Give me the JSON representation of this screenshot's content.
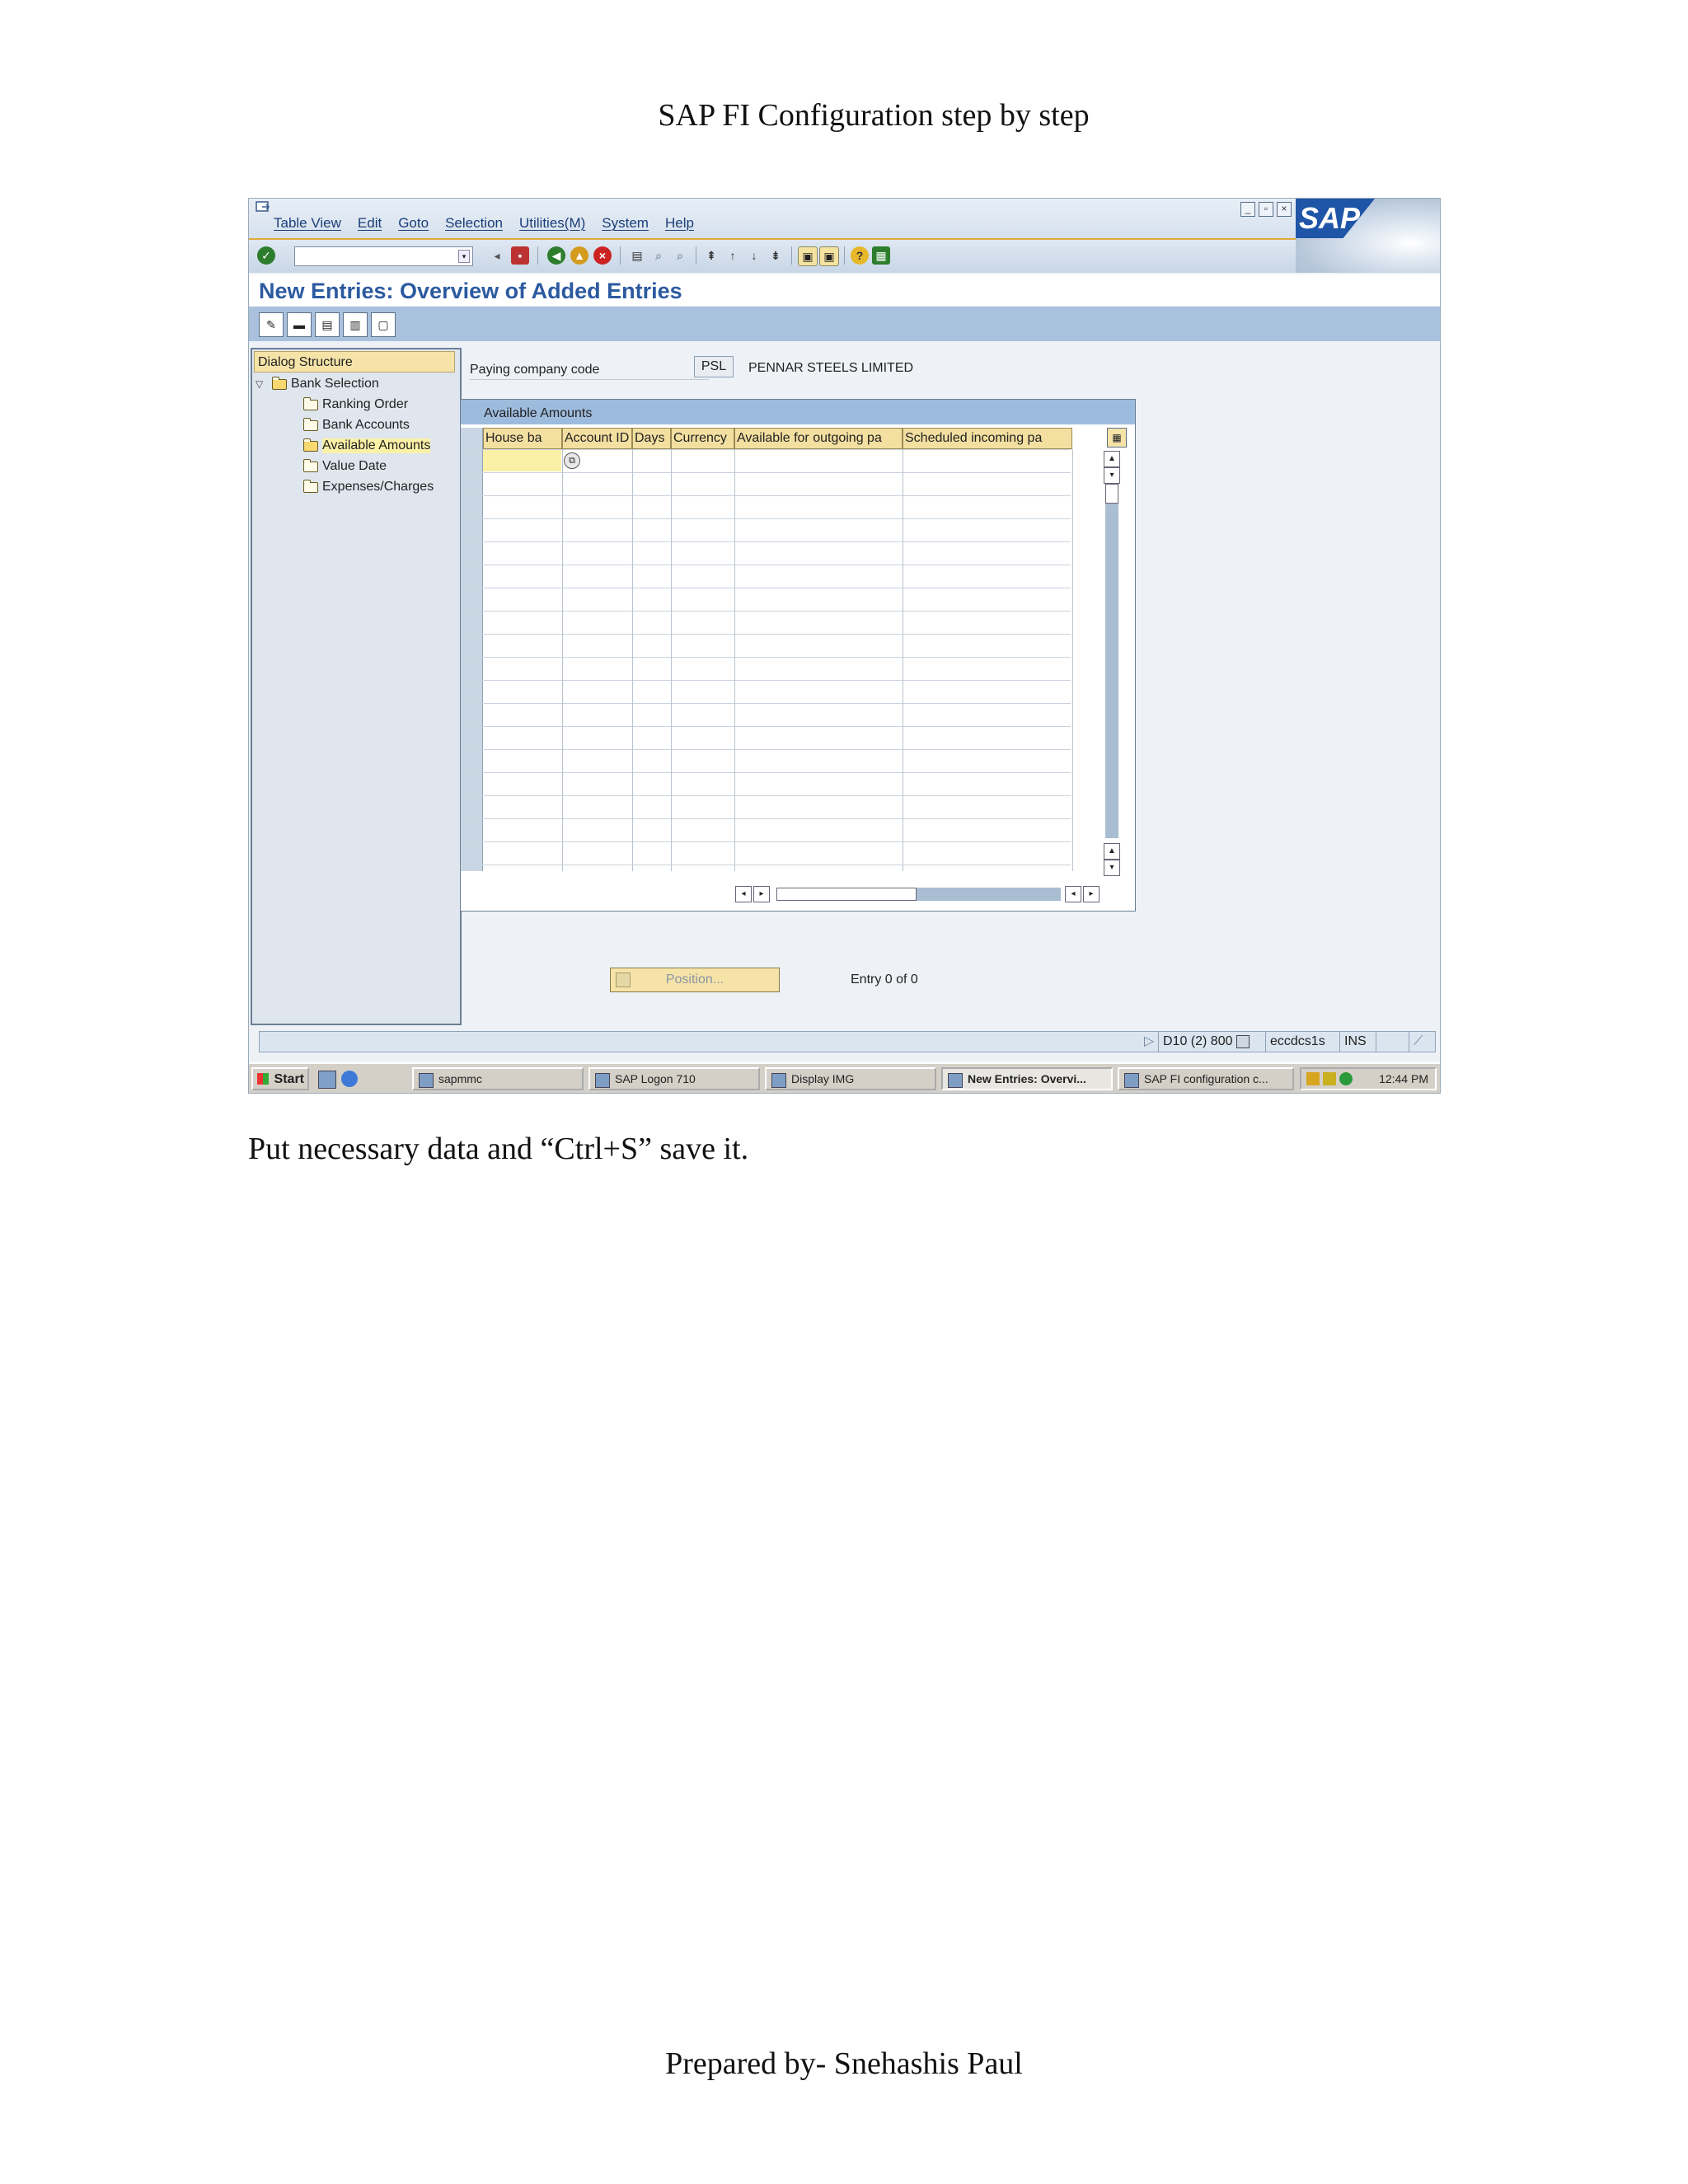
{
  "document": {
    "title": "SAP FI Configuration step by step",
    "instruction": "Put necessary data and “Ctrl+S” save it.",
    "footer": "Prepared by- Snehashis Paul"
  },
  "sap": {
    "menu": [
      "Table View",
      "Edit",
      "Goto",
      "Selection",
      "Utilities(M)",
      "System",
      "Help"
    ],
    "logo": "SAP",
    "screen_title": "New Entries: Overview of Added Entries",
    "dialog_structure": {
      "header": "Dialog Structure",
      "nodes": [
        "Bank Selection",
        "Ranking Order",
        "Bank Accounts",
        "Available Amounts",
        "Value Date",
        "Expenses/Charges"
      ]
    },
    "fields": {
      "company_code_label": "Paying company code",
      "company_code_value": "PSL",
      "company_name": "PENNAR STEELS LIMITED"
    },
    "table": {
      "title": "Available Amounts",
      "columns": [
        "House ba",
        "Account ID",
        "Days",
        "Currency",
        "Available for outgoing pa",
        "Scheduled incoming pa"
      ]
    },
    "position_button": "Position...",
    "entry_info": "Entry 0 of 0",
    "status": {
      "system": "D10 (2) 800",
      "server": "eccdcs1s",
      "mode": "INS"
    },
    "taskbar": {
      "start": "Start",
      "tasks": [
        "sapmmc",
        "SAP Logon 710",
        "Display IMG",
        "New Entries: Overvi...",
        "SAP FI configuration c..."
      ],
      "clock": "12:44 PM"
    }
  }
}
